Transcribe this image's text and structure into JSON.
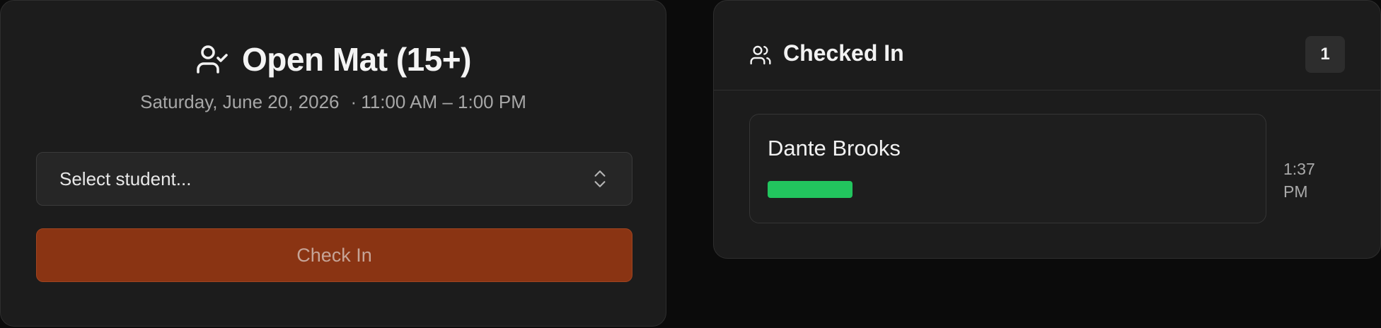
{
  "session": {
    "title": "Open Mat (15+)",
    "date": "Saturday, June 20, 2026",
    "separator": "·",
    "time_range": "11:00 AM – 1:00 PM"
  },
  "student_select": {
    "placeholder": "Select student..."
  },
  "check_in_button": {
    "label": "Check In"
  },
  "checked_in": {
    "title": "Checked In",
    "count": "1",
    "attendees": [
      {
        "name": "Dante Brooks",
        "time_line1": "1:37",
        "time_line2": "PM",
        "rank_color": "#22c55e"
      }
    ]
  },
  "icons": {
    "title_icon": "user-check-icon",
    "select_icon": "chevrons-up-down-icon",
    "header_icon": "users-icon"
  },
  "colors": {
    "accent": "#8a3413",
    "rank": "#22c55e"
  }
}
